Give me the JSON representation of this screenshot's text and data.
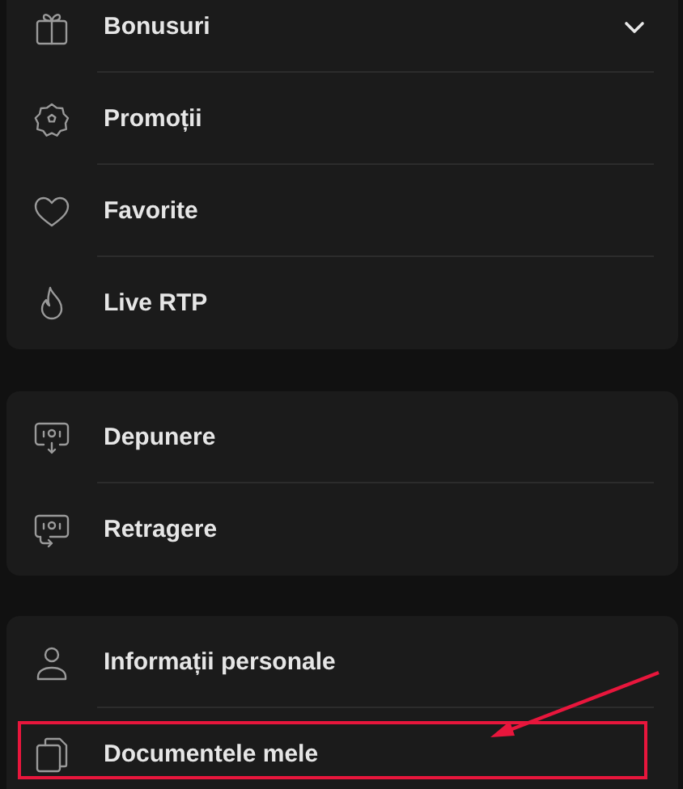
{
  "menu_groups": [
    {
      "items": [
        {
          "label": "Bonusuri",
          "expandable": true,
          "highlighted": false
        },
        {
          "label": "Promoții",
          "expandable": false,
          "highlighted": false
        },
        {
          "label": "Favorite",
          "expandable": false,
          "highlighted": false
        },
        {
          "label": "Live RTP",
          "expandable": false,
          "highlighted": false
        }
      ]
    },
    {
      "items": [
        {
          "label": "Depunere",
          "expandable": false,
          "highlighted": false
        },
        {
          "label": "Retragere",
          "expandable": false,
          "highlighted": false
        }
      ]
    },
    {
      "items": [
        {
          "label": "Informații personale",
          "expandable": false,
          "highlighted": false
        },
        {
          "label": "Documentele mele",
          "expandable": false,
          "highlighted": true
        }
      ]
    }
  ]
}
